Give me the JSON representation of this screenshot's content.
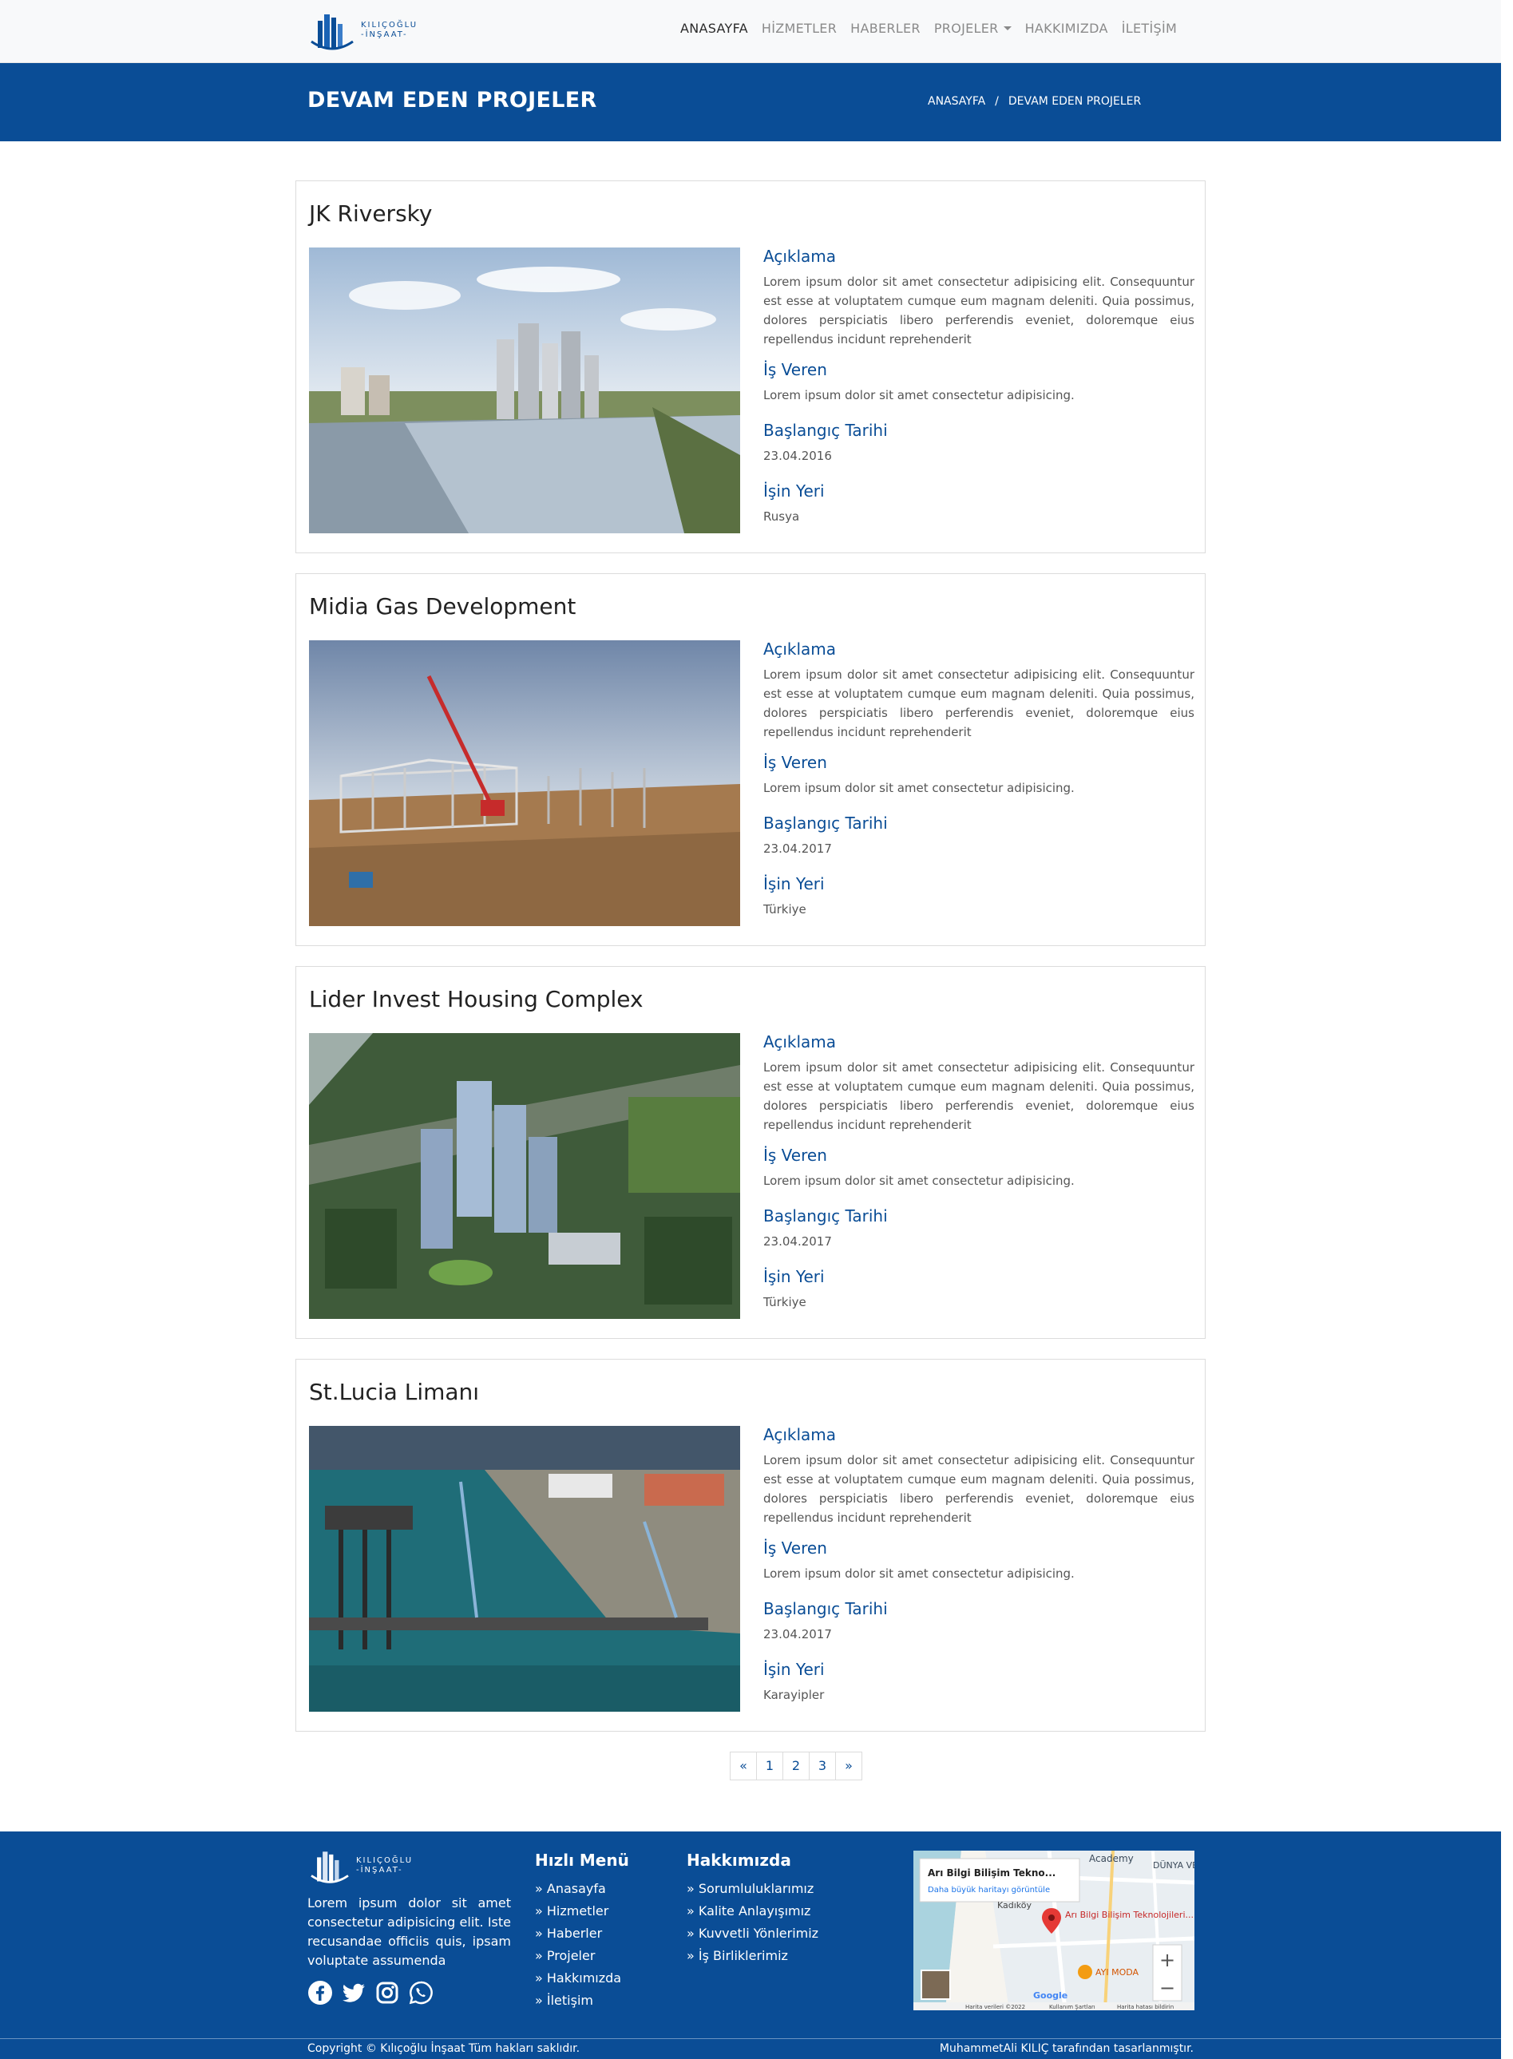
{
  "brand": {
    "name_line1": "KILIÇOĞLU",
    "name_line2": "-İNŞAAT-"
  },
  "nav": {
    "items": [
      "ANASAYFA",
      "HİZMETLER",
      "HABERLER",
      "PROJELER",
      "HAKKIMIZDA",
      "İLETİŞİM"
    ],
    "active": "ANASAYFA"
  },
  "banner": {
    "title": "DEVAM EDEN PROJELER",
    "breadcrumb": [
      "ANASAYFA",
      "/",
      "DEVAM EDEN PROJELER"
    ]
  },
  "labels": {
    "description": "Açıklama",
    "employer": "İş Veren",
    "start_date": "Başlangıç Tarihi",
    "location": "İşin Yeri"
  },
  "projects": [
    {
      "title": "JK Riversky",
      "description": "Lorem ipsum dolor sit amet consectetur adipisicing elit. Consequuntur est esse at voluptatem cumque eum magnam deleniti. Quia possimus, dolores perspiciatis libero perferendis eveniet, doloremque eius repellendus incidunt reprehenderit",
      "employer": "Lorem ipsum dolor sit amet consectetur adipisicing.",
      "start_date": "23.04.2016",
      "location": "Rusya"
    },
    {
      "title": "Midia Gas Development",
      "description": "Lorem ipsum dolor sit amet consectetur adipisicing elit. Consequuntur est esse at voluptatem cumque eum magnam deleniti. Quia possimus, dolores perspiciatis libero perferendis eveniet, doloremque eius repellendus incidunt reprehenderit",
      "employer": "Lorem ipsum dolor sit amet consectetur adipisicing.",
      "start_date": "23.04.2017",
      "location": "Türkiye"
    },
    {
      "title": "Lider Invest Housing Complex",
      "description": "Lorem ipsum dolor sit amet consectetur adipisicing elit. Consequuntur est esse at voluptatem cumque eum magnam deleniti. Quia possimus, dolores perspiciatis libero perferendis eveniet, doloremque eius repellendus incidunt reprehenderit",
      "employer": "Lorem ipsum dolor sit amet consectetur adipisicing.",
      "start_date": "23.04.2017",
      "location": "Türkiye"
    },
    {
      "title": "St.Lucia Limanı",
      "description": "Lorem ipsum dolor sit amet consectetur adipisicing elit. Consequuntur est esse at voluptatem cumque eum magnam deleniti. Quia possimus, dolores perspiciatis libero perferendis eveniet, doloremque eius repellendus incidunt reprehenderit",
      "employer": "Lorem ipsum dolor sit amet consectetur adipisicing.",
      "start_date": "23.04.2017",
      "location": "Karayipler"
    }
  ],
  "pagination": [
    "«",
    "1",
    "2",
    "3",
    "»"
  ],
  "footer": {
    "about": "Lorem ipsum dolor sit amet consectetur adipisicing elit. Iste recusandae officiis quis, ipsam voluptate assumenda",
    "quick_menu_title": "Hızlı Menü",
    "quick_menu": [
      "» Anasayfa",
      "» Hizmetler",
      "» Haberler",
      "» Projeler",
      "» Hakkımızda",
      "» İletişim"
    ],
    "about_title": "Hakkımızda",
    "about_menu": [
      "» Sorumluluklarımız",
      "» Kalite Anlayışımız",
      "» Kuvvetli Yönlerimiz",
      "» İş Birliklerimiz"
    ],
    "social_icons": [
      "facebook-icon",
      "twitter-icon",
      "instagram-icon",
      "whatsapp-icon"
    ],
    "map": {
      "place_title": "Arı Bilgi Bilişim Tekno...",
      "bigger_map_link": "Daha büyük haritayı görüntüle",
      "pin_label": "Arı Bilgi Bilişim Teknolojileri...",
      "poi_label": "AYI MODA",
      "district": "Kadıköy",
      "poi_top": "Academy",
      "poi_right": "DÜNYA VE MI",
      "footer_data": "Harita verileri ©2022",
      "footer_terms": "Kullanım Şartları",
      "footer_report": "Harita hatası bildirin",
      "brand": "Google"
    },
    "copyright": "Copyright © Kılıçoğlu İnşaat Tüm hakları saklıdır.",
    "designer": "MuhammetAli KILIÇ tarafından tasarlanmıştır."
  },
  "colors": {
    "primary": "#0a4d96",
    "nav_bg": "#f8f9fa",
    "link_gray": "#8a8a8a"
  }
}
